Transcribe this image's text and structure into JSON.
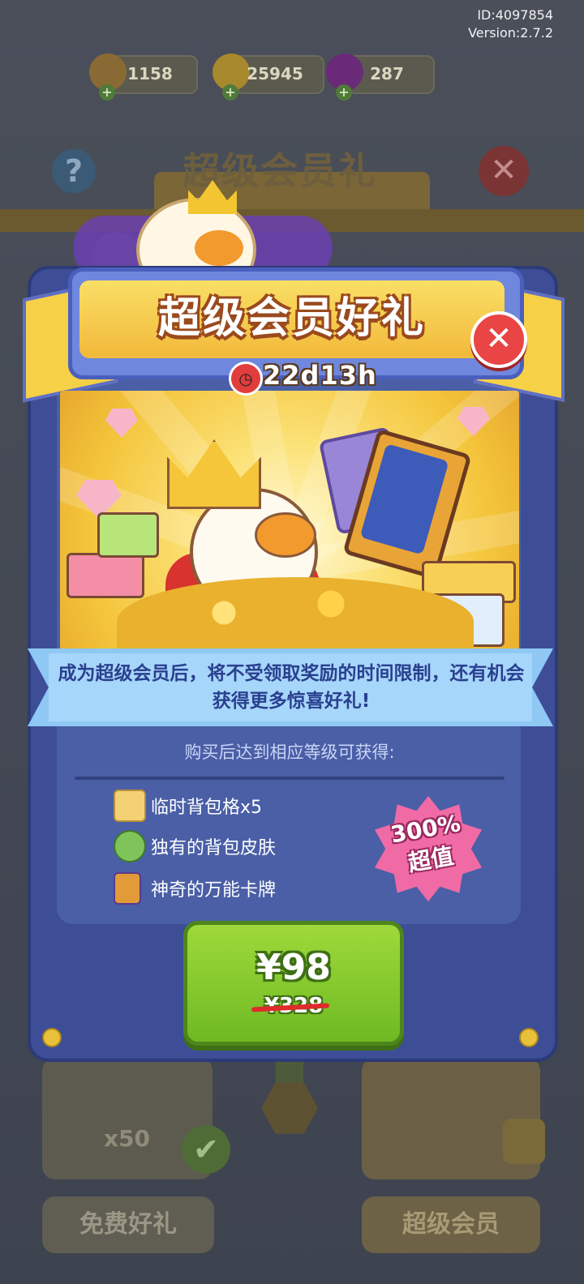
{
  "meta": {
    "id_line": "ID:4097854",
    "version_line": "Version:2.7.2"
  },
  "resources": [
    {
      "name": "ticket",
      "value": "1158",
      "color": "#b07a2e"
    },
    {
      "name": "coin",
      "value": "25945",
      "color": "#d9a62a"
    },
    {
      "name": "gem",
      "value": "287",
      "color": "#8c2fa0"
    }
  ],
  "background": {
    "title": "超级会员礼",
    "timer": "22d13h",
    "bottom_left_count": "x50",
    "bottom_left_button": "免费好礼",
    "bottom_right_button": "超级会员"
  },
  "modal": {
    "title": "超级会员好礼",
    "timer": "22d13h",
    "description": "成为超级会员后，将不受领取奖励的时间限制，还有机会获得更多惊喜好礼!",
    "subheading": "购买后达到相应等级可获得:",
    "perks": [
      {
        "label": "临时背包格x5",
        "icon": "backpack-slot-icon",
        "color": "#f4d172"
      },
      {
        "label": "独有的背包皮肤",
        "icon": "dino-backpack-icon",
        "color": "#7fc45a"
      },
      {
        "label": "神奇的万能卡牌",
        "icon": "magic-card-icon",
        "color": "#e39b3a"
      }
    ],
    "badge_percent": "300%",
    "badge_label": "超值",
    "price_now": "¥98",
    "price_old": "¥328"
  },
  "colors": {
    "modal_bg": "#3d4e97",
    "buy_button": "#7cc52a",
    "close_button": "#e94545",
    "badge": "#f06aa6"
  }
}
